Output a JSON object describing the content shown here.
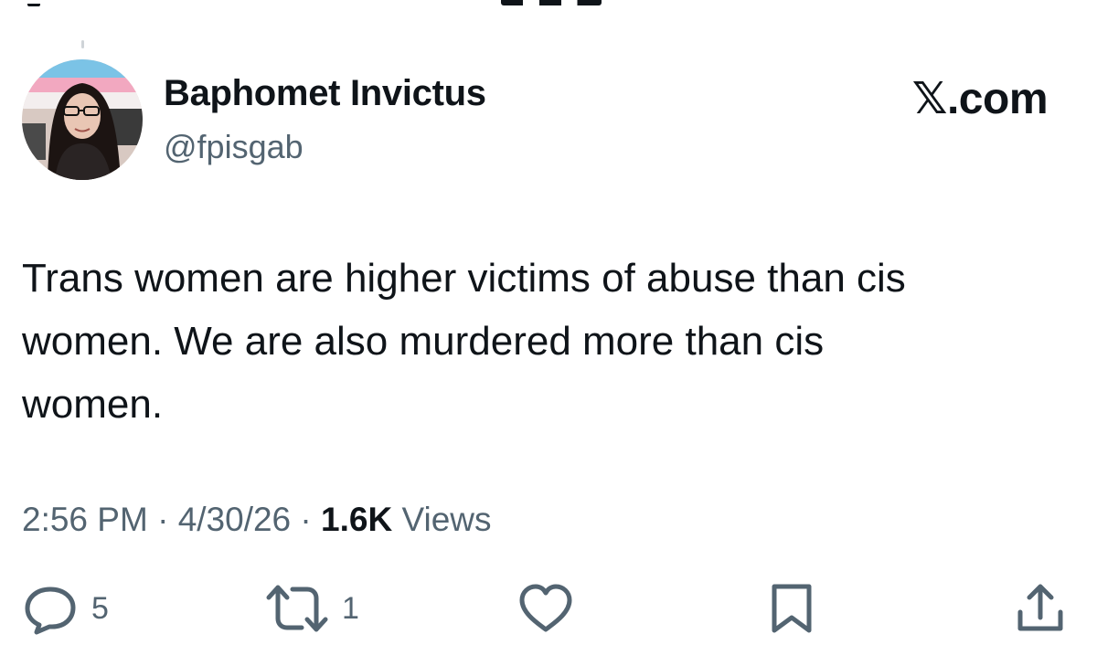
{
  "author": {
    "display_name": "Baphomet Invictus",
    "handle": "@fpisgab"
  },
  "brand": "𝕏.com",
  "post": {
    "text": "Trans women are higher victims of abuse than cis\nwomen. We are also murdered more than cis\nwomen."
  },
  "meta": {
    "time": "2:56 PM",
    "separator": "·",
    "date": "4/30/26",
    "views_count": "1.6K",
    "views_label": "Views"
  },
  "actions": {
    "reply_count": "5",
    "repost_count": "1"
  },
  "icons": {
    "reply": "reply-icon",
    "repost": "repost-icon",
    "like": "heart-icon",
    "bookmark": "bookmark-icon",
    "share": "share-icon"
  },
  "colors": {
    "text_primary": "#0f1419",
    "text_secondary": "#536471"
  }
}
